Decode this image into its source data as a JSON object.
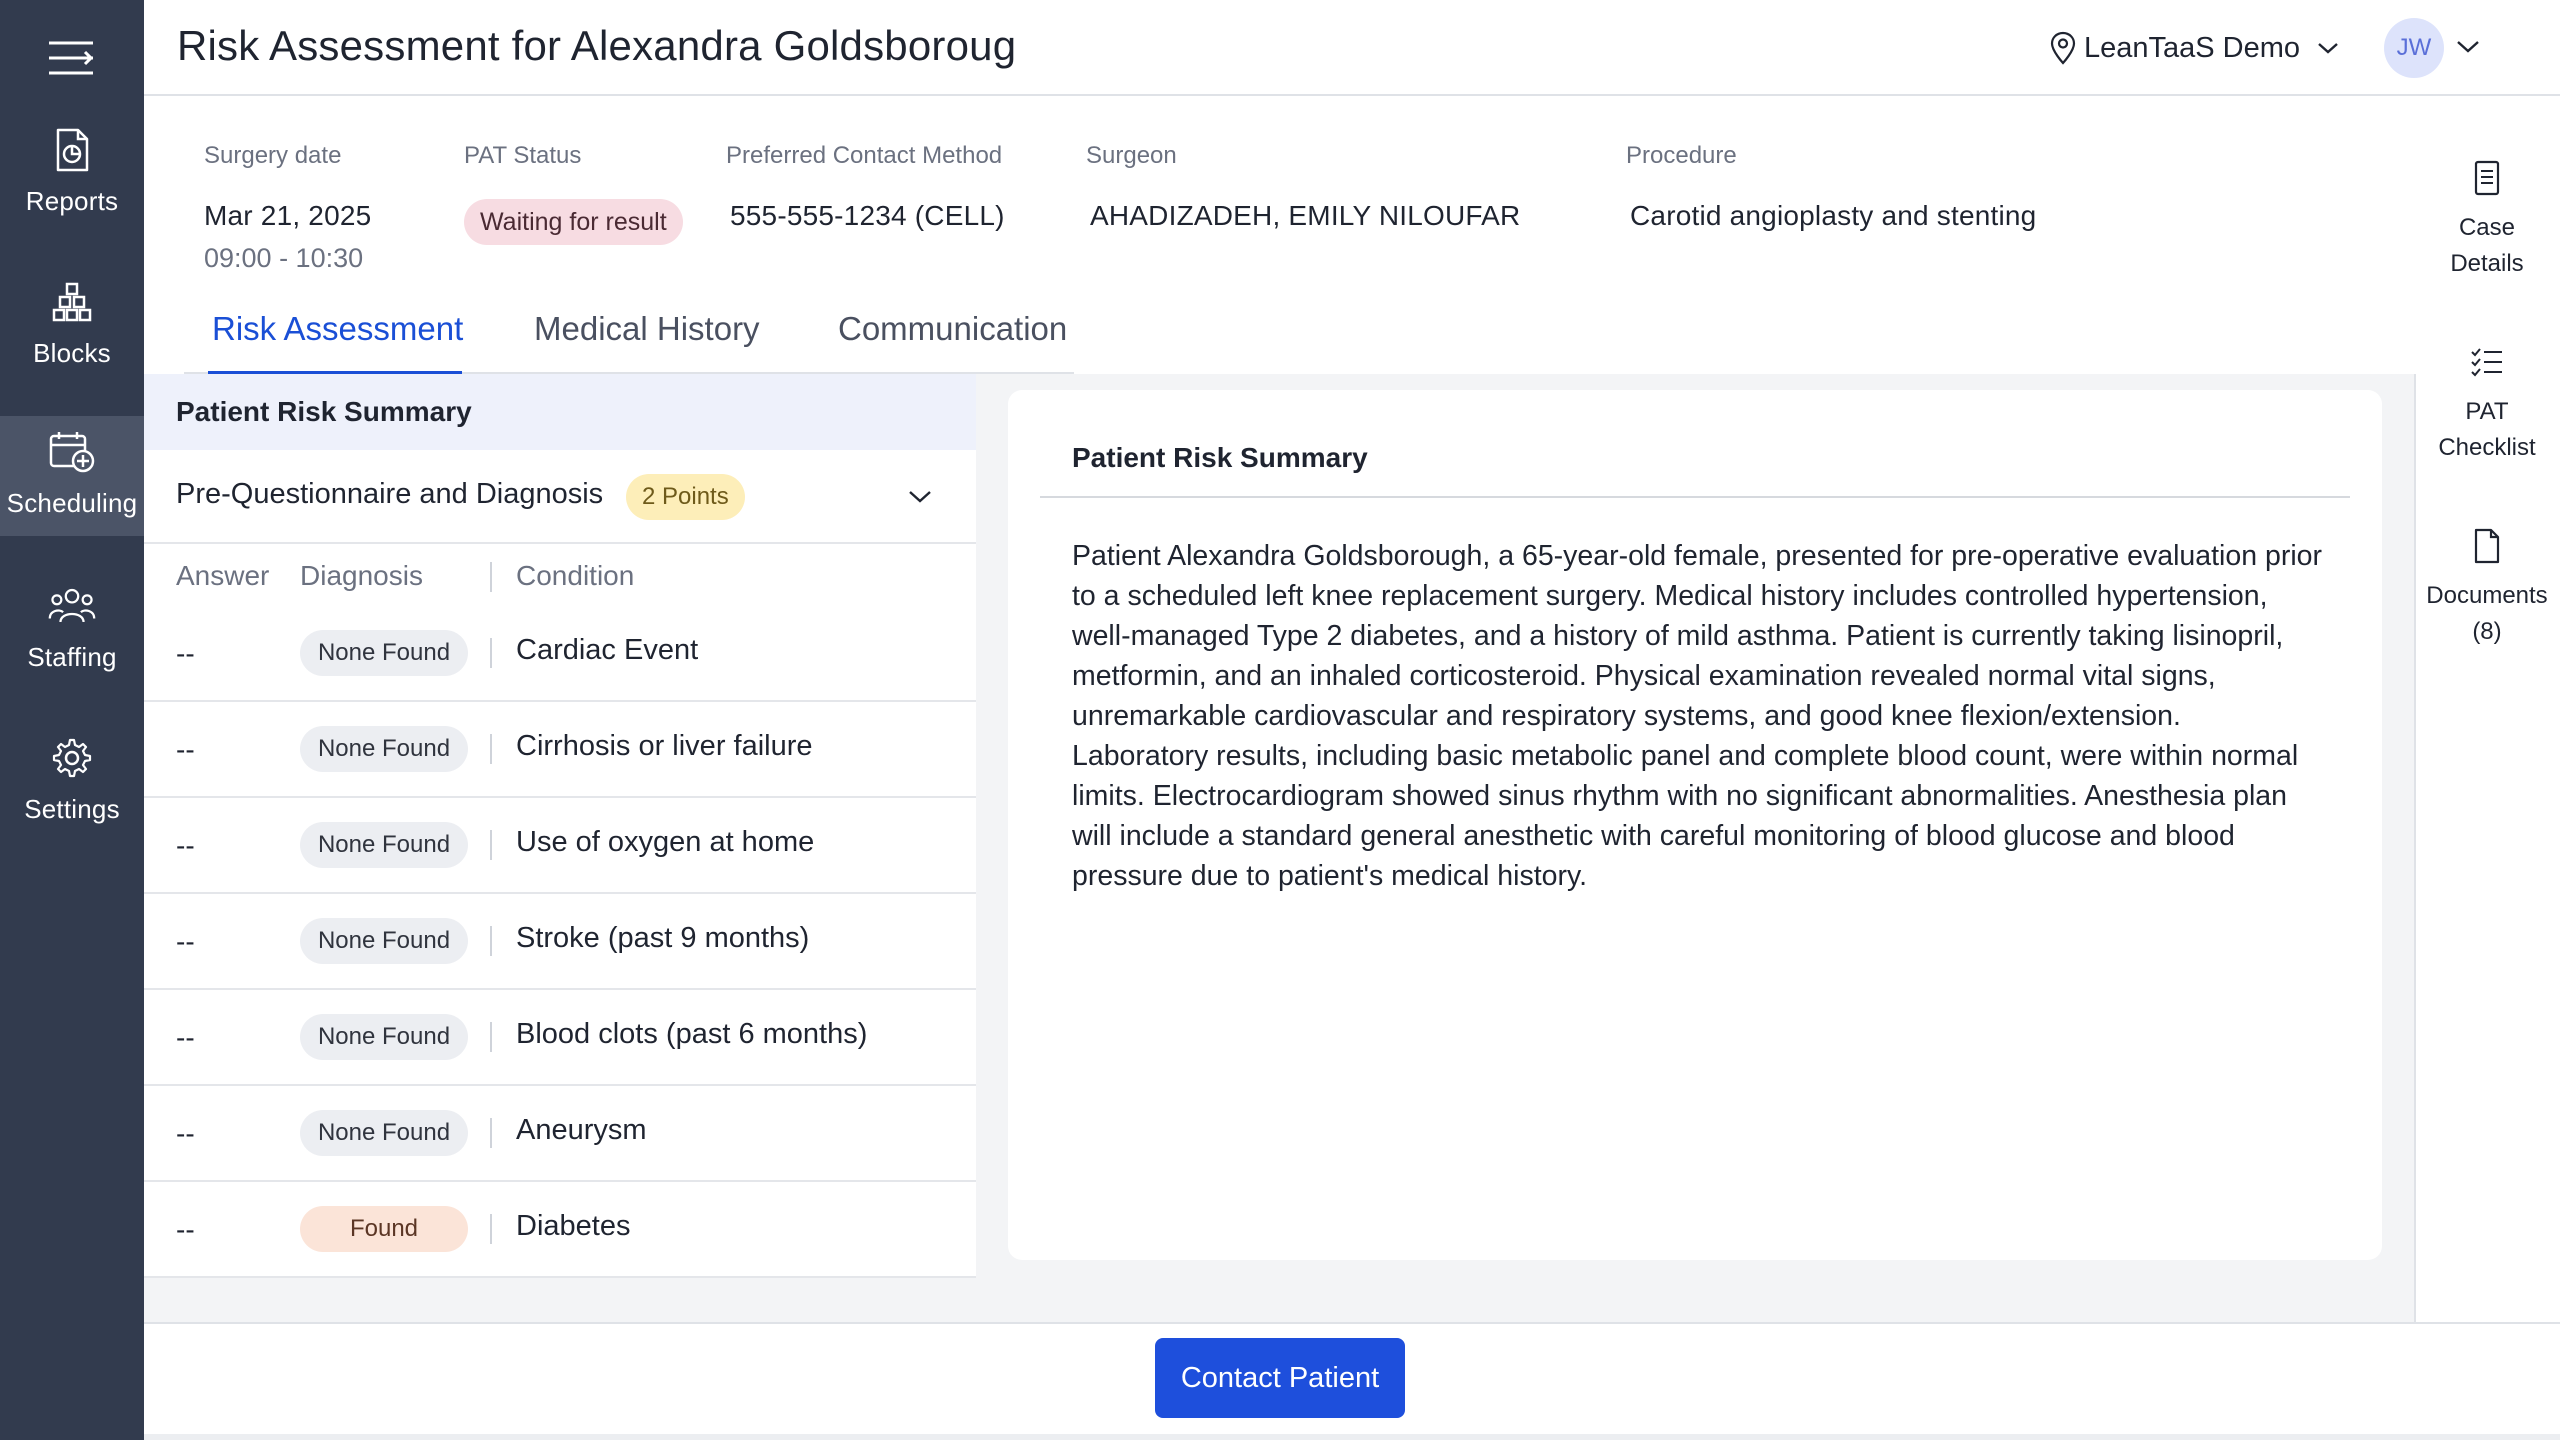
{
  "nav": {
    "items": [
      {
        "label": "Reports",
        "icon": "reports-icon"
      },
      {
        "label": "Blocks",
        "icon": "blocks-icon"
      },
      {
        "label": "Scheduling",
        "icon": "scheduling-icon"
      },
      {
        "label": "Staffing",
        "icon": "staffing-icon"
      },
      {
        "label": "Settings",
        "icon": "gear-icon"
      }
    ],
    "active": "Scheduling"
  },
  "header": {
    "title": "Risk Assessment for Alexandra Goldsboroug",
    "location": "LeanTaaS Demo",
    "avatar_initials": "JW"
  },
  "case": {
    "surgery_date_label": "Surgery date",
    "surgery_date": "Mar 21, 2025",
    "surgery_time": "09:00 - 10:30",
    "pat_status_label": "PAT Status",
    "pat_status": "Waiting for result",
    "contact_label": "Preferred Contact Method",
    "contact": "555-555-1234 (CELL)",
    "surgeon_label": "Surgeon",
    "surgeon": "AHADIZADEH, EMILY NILOUFAR",
    "procedure_label": "Procedure",
    "procedure": "Carotid angioplasty and stenting"
  },
  "tabs": [
    {
      "label": "Risk Assessment",
      "active": true
    },
    {
      "label": "Medical History",
      "active": false
    },
    {
      "label": "Communication",
      "active": false
    }
  ],
  "right_sidebar": {
    "items": [
      {
        "label": "Case\nDetails",
        "icon": "document-lines-icon"
      },
      {
        "label": "PAT\nChecklist",
        "icon": "checklist-icon"
      },
      {
        "label": "Documents\n(8)",
        "icon": "file-icon"
      }
    ]
  },
  "risk": {
    "panel_title": "Patient Risk Summary",
    "section_title": "Pre-Questionnaire and Diagnosis",
    "section_points": "2 Points",
    "columns": {
      "answer": "Answer",
      "diagnosis": "Diagnosis",
      "condition": "Condition"
    },
    "rows": [
      {
        "answer": "--",
        "diagnosis": "None Found",
        "condition": "Cardiac Event",
        "found": false
      },
      {
        "answer": "--",
        "diagnosis": "None Found",
        "condition": "Cirrhosis or liver failure",
        "found": false
      },
      {
        "answer": "--",
        "diagnosis": "None Found",
        "condition": "Use of oxygen at home",
        "found": false
      },
      {
        "answer": "--",
        "diagnosis": "None Found",
        "condition": "Stroke (past 9 months)",
        "found": false
      },
      {
        "answer": "--",
        "diagnosis": "None Found",
        "condition": "Blood clots (past 6 months)",
        "found": false
      },
      {
        "answer": "--",
        "diagnosis": "None Found",
        "condition": "Aneurysm",
        "found": false
      },
      {
        "answer": "--",
        "diagnosis": "Found",
        "condition": "Diabetes",
        "found": true
      }
    ]
  },
  "summary": {
    "title": "Patient Risk Summary",
    "text": "Patient Alexandra Goldsborough, a 65-year-old female, presented for pre-operative evaluation prior to a scheduled left knee replacement surgery. Medical history includes controlled hypertension, well-managed Type 2 diabetes, and a history of mild asthma. Patient is currently taking lisinopril, metformin, and an inhaled corticosteroid. Physical examination revealed normal vital signs, unremarkable cardiovascular and respiratory systems, and good knee flexion/extension. Laboratory results, including basic metabolic panel and complete blood count, were within normal limits. Electrocardiogram showed sinus rhythm with no significant abnormalities. Anesthesia plan will include a standard general anesthetic with careful monitoring of blood glucose and blood pressure due to patient's medical history."
  },
  "footer": {
    "contact_button": "Contact Patient"
  },
  "colors": {
    "nav_bg": "#323b4e",
    "nav_active": "#4b5467",
    "accent": "#1a4fd6",
    "button": "#1e4fdc",
    "pat_badge": "#f7dce2",
    "points_badge": "#fdeeb9",
    "found_badge": "#fbe4d8",
    "none_badge": "#eceef2"
  }
}
